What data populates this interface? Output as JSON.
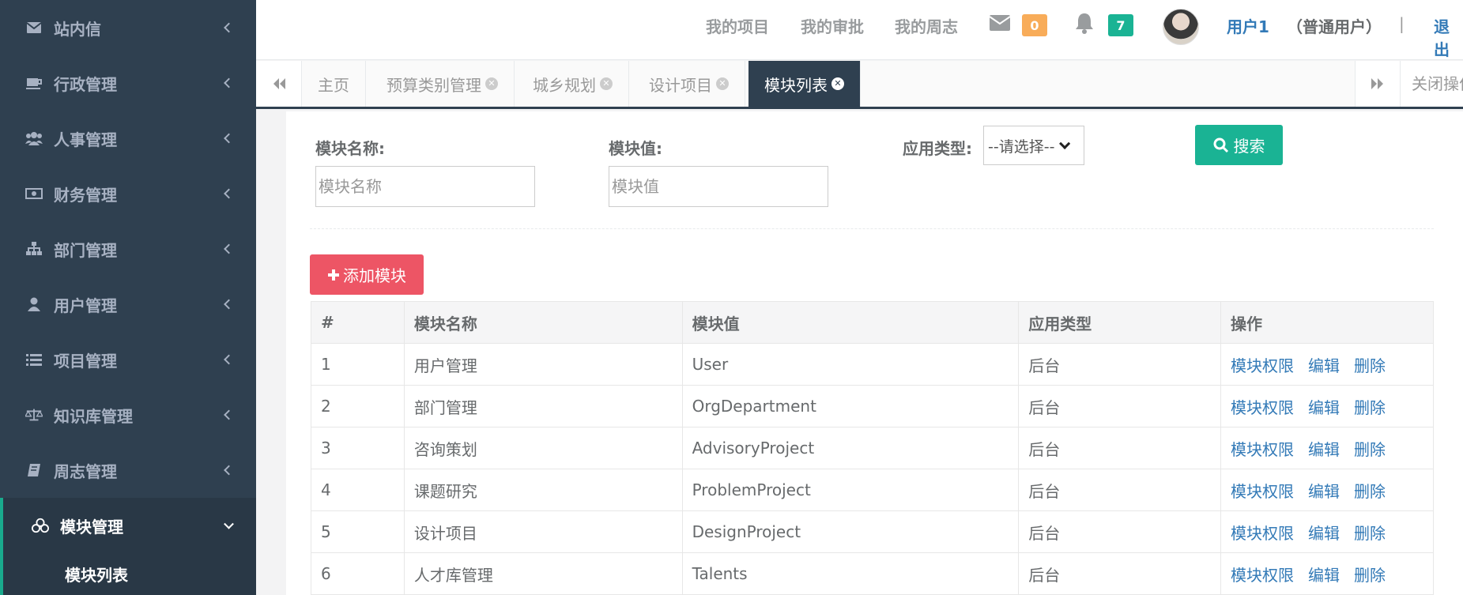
{
  "sidebar": {
    "items": [
      {
        "label": "站内信",
        "icon": "envelope-icon"
      },
      {
        "label": "行政管理",
        "icon": "coffee-icon"
      },
      {
        "label": "人事管理",
        "icon": "users-icon"
      },
      {
        "label": "财务管理",
        "icon": "money-icon"
      },
      {
        "label": "部门管理",
        "icon": "sitemap-icon"
      },
      {
        "label": "用户管理",
        "icon": "user-icon"
      },
      {
        "label": "项目管理",
        "icon": "list-icon"
      },
      {
        "label": "知识库管理",
        "icon": "balance-scale-icon"
      },
      {
        "label": "周志管理",
        "icon": "book-icon"
      },
      {
        "label": "模块管理",
        "icon": "cubes-icon"
      }
    ],
    "sub_item": "模块列表"
  },
  "header": {
    "links": [
      "我的项目",
      "我的审批",
      "我的周志"
    ],
    "mail_count": "0",
    "notify_count": "7",
    "user_name": "用户1",
    "user_role": "（普通用户）",
    "separator": "|",
    "logout": "退出"
  },
  "tabs": {
    "items": [
      {
        "label": "主页",
        "closable": false
      },
      {
        "label": "预算类别管理",
        "closable": true
      },
      {
        "label": "城乡规划",
        "closable": true
      },
      {
        "label": "设计项目",
        "closable": true
      },
      {
        "label": "模块列表",
        "closable": true,
        "active": true
      }
    ],
    "close_ops": "关闭操作"
  },
  "search": {
    "name_label": "模块名称:",
    "name_placeholder": "模块名称",
    "value_label": "模块值:",
    "value_placeholder": "模块值",
    "type_label": "应用类型:",
    "type_selected": "--请选择--",
    "search_button": "搜索"
  },
  "add_button": "添加模块",
  "table": {
    "headers": [
      "#",
      "模块名称",
      "模块值",
      "应用类型",
      "操作"
    ],
    "actions": [
      "模块权限",
      "编辑",
      "删除"
    ],
    "rows": [
      [
        "1",
        "用户管理",
        "User",
        "后台"
      ],
      [
        "2",
        "部门管理",
        "OrgDepartment",
        "后台"
      ],
      [
        "3",
        "咨询策划",
        "AdvisoryProject",
        "后台"
      ],
      [
        "4",
        "课题研究",
        "ProblemProject",
        "后台"
      ],
      [
        "5",
        "设计项目",
        "DesignProject",
        "后台"
      ],
      [
        "6",
        "人才库管理",
        "Talents",
        "后台"
      ]
    ]
  },
  "colors": {
    "sidebar_bg": "#2f4050",
    "primary": "#1ab394",
    "danger": "#ed5565",
    "warning": "#f8ac59",
    "link": "#337ab7"
  }
}
